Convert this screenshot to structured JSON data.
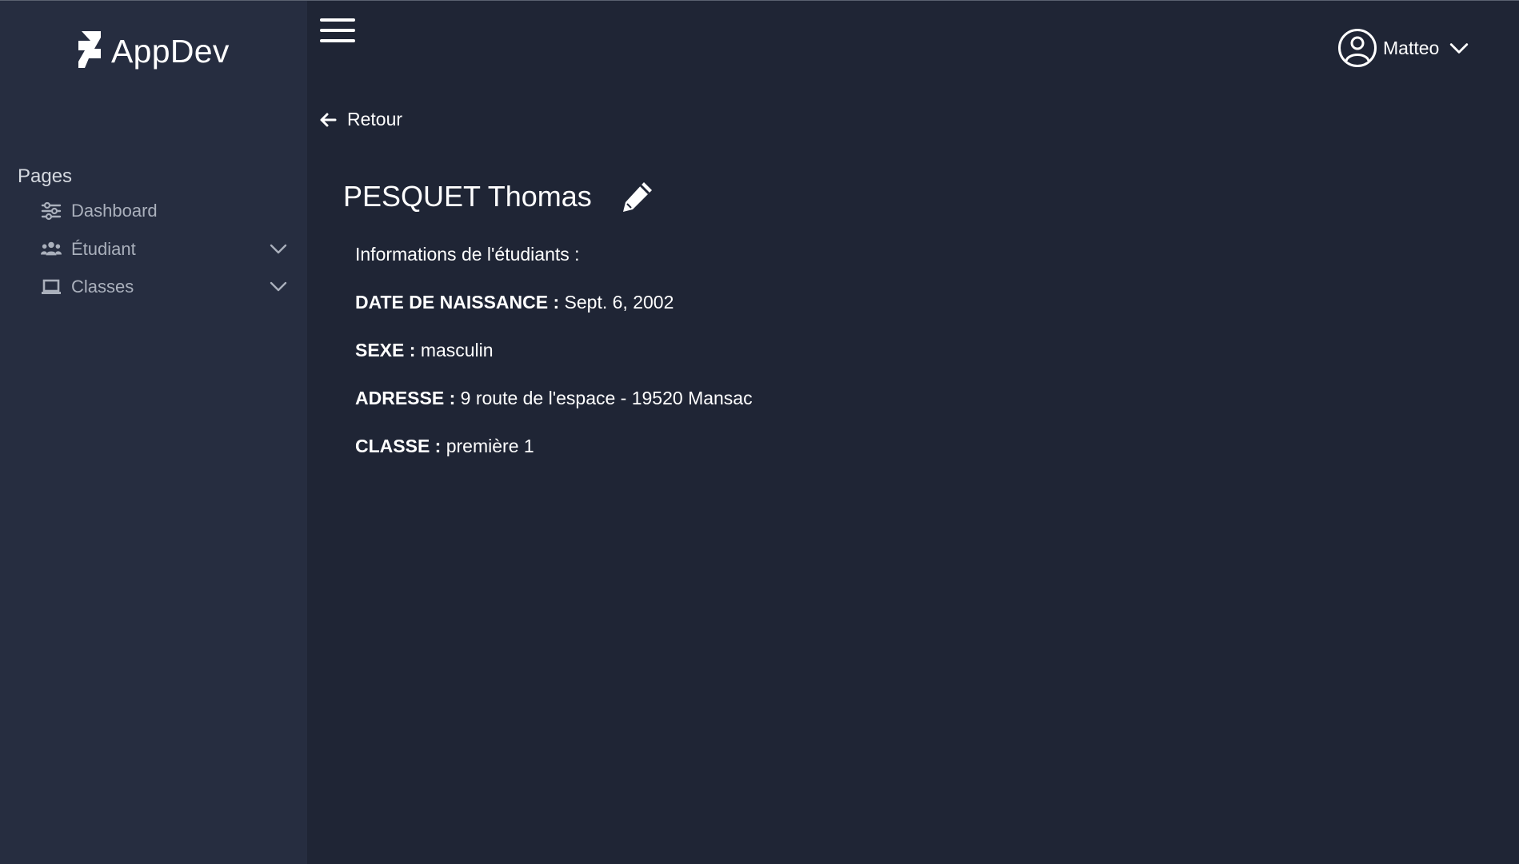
{
  "brand": {
    "name": "AppDev",
    "icon": "deviantart-logo-icon"
  },
  "sidebar": {
    "heading": "Pages",
    "items": [
      {
        "label": "Dashboard",
        "icon": "sliders-icon",
        "has_submenu": false
      },
      {
        "label": "Étudiant",
        "icon": "users-icon",
        "has_submenu": true
      },
      {
        "label": "Classes",
        "icon": "laptop-icon",
        "has_submenu": true
      }
    ]
  },
  "header": {
    "menu_icon": "hamburger-menu-icon",
    "user": {
      "name": "Matteo",
      "icon": "user-circle-icon"
    }
  },
  "content": {
    "back_label": "Retour",
    "student_name": "PESQUET Thomas",
    "edit_icon": "pencil-icon",
    "info_title": "Informations de l'étudiants :",
    "fields": [
      {
        "label": "DATE DE NAISSANCE :",
        "value": "Sept. 6, 2002"
      },
      {
        "label": "SEXE :",
        "value": "masculin"
      },
      {
        "label": "ADRESSE :",
        "value": "9 route de l'espace - 19520 Mansac"
      },
      {
        "label": "CLASSE :",
        "value": "première 1"
      }
    ]
  },
  "colors": {
    "background": "#1f2535",
    "sidebar": "#262d40",
    "nav_text": "#aab0bc",
    "text": "#ffffff"
  }
}
